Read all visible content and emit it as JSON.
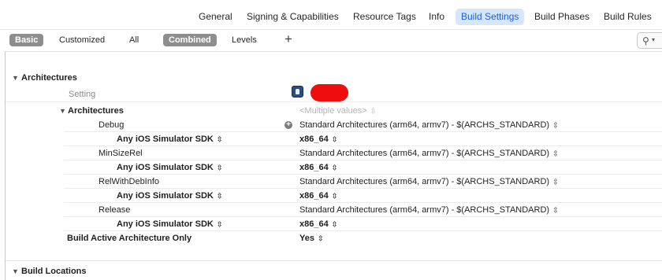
{
  "tabs": [
    {
      "label": "General",
      "active": false
    },
    {
      "label": "Signing & Capabilities",
      "active": false
    },
    {
      "label": "Resource Tags",
      "active": false
    },
    {
      "label": "Info",
      "active": false
    },
    {
      "label": "Build Settings",
      "active": true
    },
    {
      "label": "Build Phases",
      "active": false
    },
    {
      "label": "Build Rules",
      "active": false
    }
  ],
  "filters": {
    "scope": [
      "Basic",
      "Customized",
      "All"
    ],
    "scope_selected": "Basic",
    "display": [
      "Combined",
      "Levels"
    ],
    "display_selected": "Combined",
    "add": "+"
  },
  "search": {
    "icon": "magnifier-icon"
  },
  "colors": {
    "accent": "#1d5fd6",
    "active_tab_bg": "#d6e6fb",
    "redaction": "#ee0e0e"
  },
  "sections": {
    "architectures": {
      "title": "Architectures",
      "setting_label": "Setting",
      "group": {
        "title": "Architectures",
        "value": "<Multiple values>",
        "rows": [
          {
            "config": "Debug",
            "value": "Standard Architectures (arm64, armv7)  -  $(ARCHS_STANDARD)",
            "sdk": "Any iOS Simulator SDK",
            "sdk_value": "x86_64"
          },
          {
            "config": "MinSizeRel",
            "value": "Standard Architectures (arm64, armv7)  -  $(ARCHS_STANDARD)",
            "sdk": "Any iOS Simulator SDK",
            "sdk_value": "x86_64"
          },
          {
            "config": "RelWithDebInfo",
            "value": "Standard Architectures (arm64, armv7)  -  $(ARCHS_STANDARD)",
            "sdk": "Any iOS Simulator SDK",
            "sdk_value": "x86_64"
          },
          {
            "config": "Release",
            "value": "Standard Architectures (arm64, armv7)  -  $(ARCHS_STANDARD)",
            "sdk": "Any iOS Simulator SDK",
            "sdk_value": "x86_64"
          }
        ]
      },
      "active_arch": {
        "label": "Build Active Architecture Only",
        "value": "Yes"
      }
    },
    "build_locations": {
      "title": "Build Locations"
    }
  }
}
